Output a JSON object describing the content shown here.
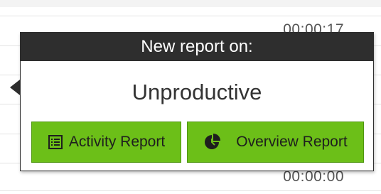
{
  "background": {
    "times": [
      "00:00:17",
      "00:00:00"
    ]
  },
  "popover": {
    "header": "New report on:",
    "subject": "Unproductive",
    "buttons": {
      "activity_label": "Activity Report",
      "activity_icon": "list-icon",
      "overview_label": "Overview Report",
      "overview_icon": "pie-chart-icon"
    }
  },
  "colors": {
    "header_bg": "#2e2e2e",
    "button_green": "#6cbf18"
  }
}
